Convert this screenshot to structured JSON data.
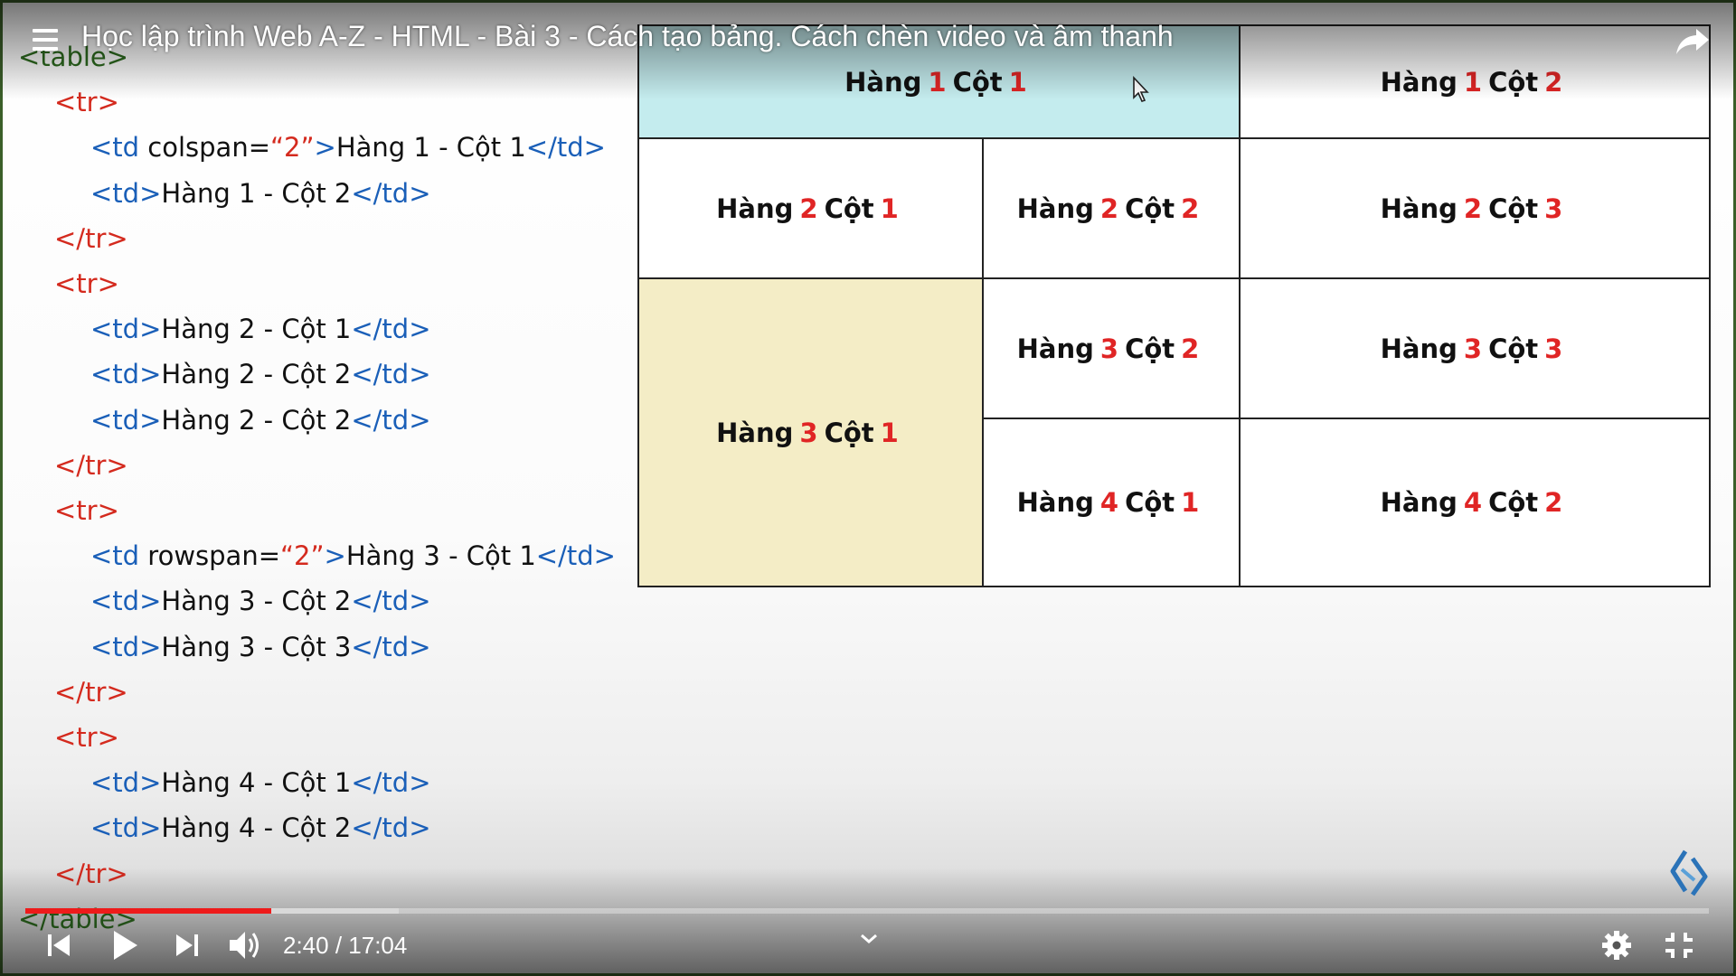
{
  "video": {
    "title": "Học lập trình Web A-Z - HTML - Bài 3 - Cách tạo bảng. Cách chèn video và âm thanh",
    "current_time": "2:40",
    "separator": " / ",
    "duration": "17:04",
    "progress_played": 0.146,
    "progress_buffered": 0.222
  },
  "code_lines": [
    [
      {
        "t": "<table>",
        "c": "grn"
      }
    ],
    [
      {
        "t": "<tr>",
        "c": "red"
      }
    ],
    [
      {
        "t": "<td ",
        "c": "blue"
      },
      {
        "t": "colspan=",
        "c": "blk"
      },
      {
        "t": "“2”",
        "c": "red"
      },
      {
        "t": ">",
        "c": "blue"
      },
      {
        "t": "Hàng 1 - Cột 1",
        "c": "blk"
      },
      {
        "t": "</td>",
        "c": "blue"
      }
    ],
    [
      {
        "t": "<td>",
        "c": "blue"
      },
      {
        "t": "Hàng 1 - Cột 2",
        "c": "blk"
      },
      {
        "t": "</td>",
        "c": "blue"
      }
    ],
    [
      {
        "t": "</tr>",
        "c": "red"
      }
    ],
    [
      {
        "t": "<tr>",
        "c": "red"
      }
    ],
    [
      {
        "t": "<td>",
        "c": "blue"
      },
      {
        "t": "Hàng 2 - Cột 1",
        "c": "blk"
      },
      {
        "t": "</td>",
        "c": "blue"
      }
    ],
    [
      {
        "t": "<td>",
        "c": "blue"
      },
      {
        "t": "Hàng 2 - Cột 2",
        "c": "blk"
      },
      {
        "t": "</td>",
        "c": "blue"
      }
    ],
    [
      {
        "t": "<td>",
        "c": "blue"
      },
      {
        "t": "Hàng 2 - Cột 2",
        "c": "blk"
      },
      {
        "t": "</td>",
        "c": "blue"
      }
    ],
    [
      {
        "t": "</tr>",
        "c": "red"
      }
    ],
    [
      {
        "t": "<tr>",
        "c": "red"
      }
    ],
    [
      {
        "t": "<td ",
        "c": "blue"
      },
      {
        "t": "rowspan=",
        "c": "blk"
      },
      {
        "t": "“2”",
        "c": "red"
      },
      {
        "t": ">",
        "c": "blue"
      },
      {
        "t": "Hàng 3 - Cột 1",
        "c": "blk"
      },
      {
        "t": "</td>",
        "c": "blue"
      }
    ],
    [
      {
        "t": "<td>",
        "c": "blue"
      },
      {
        "t": "Hàng 3 - Cột 2",
        "c": "blk"
      },
      {
        "t": "</td>",
        "c": "blue"
      }
    ],
    [
      {
        "t": "<td>",
        "c": "blue"
      },
      {
        "t": "Hàng 3 - Cột 3",
        "c": "blk"
      },
      {
        "t": "</td>",
        "c": "blue"
      }
    ],
    [
      {
        "t": "</tr>",
        "c": "red"
      }
    ],
    [
      {
        "t": "<tr>",
        "c": "red"
      }
    ],
    [
      {
        "t": "<td>",
        "c": "blue"
      },
      {
        "t": "Hàng 4 - Cột 1",
        "c": "blk"
      },
      {
        "t": "</td>",
        "c": "blue"
      }
    ],
    [
      {
        "t": "<td>",
        "c": "blue"
      },
      {
        "t": "Hàng 4 - Cột 2",
        "c": "blk"
      },
      {
        "t": "</td>",
        "c": "blue"
      }
    ],
    [
      {
        "t": "</tr>",
        "c": "red"
      }
    ],
    [
      {
        "t": "</table>",
        "c": "grn"
      }
    ]
  ],
  "table_cells": [
    {
      "id": "r1c1",
      "word1": "Hàng",
      "row": "1",
      "word2": "Cột",
      "col": "1",
      "fill": "#c4ecee"
    },
    {
      "id": "r1c2",
      "word1": "Hàng",
      "row": "1",
      "word2": "Cột",
      "col": "2",
      "fill": "#ffffff"
    },
    {
      "id": "r2c1",
      "word1": "Hàng",
      "row": "2",
      "word2": "Cột",
      "col": "1",
      "fill": "#ffffff"
    },
    {
      "id": "r2c2",
      "word1": "Hàng",
      "row": "2",
      "word2": "Cột",
      "col": "2",
      "fill": "#ffffff"
    },
    {
      "id": "r2c3",
      "word1": "Hàng",
      "row": "2",
      "word2": "Cột",
      "col": "3",
      "fill": "#ffffff"
    },
    {
      "id": "r3c1",
      "word1": "Hàng",
      "row": "3",
      "word2": "Cột",
      "col": "1",
      "fill": "#f4edc6"
    },
    {
      "id": "r3c2",
      "word1": "Hàng",
      "row": "3",
      "word2": "Cột",
      "col": "2",
      "fill": "#ffffff"
    },
    {
      "id": "r3c3",
      "word1": "Hàng",
      "row": "3",
      "word2": "Cột",
      "col": "3",
      "fill": "#ffffff"
    },
    {
      "id": "r4c1",
      "word1": "Hàng",
      "row": "4",
      "word2": "Cột",
      "col": "1",
      "fill": "#ffffff"
    },
    {
      "id": "r4c2",
      "word1": "Hàng",
      "row": "4",
      "word2": "Cột",
      "col": "2",
      "fill": "#ffffff"
    }
  ],
  "icons": {
    "menu": "menu-icon",
    "share": "share-icon",
    "previous": "previous-icon",
    "play": "play-icon",
    "next": "next-icon",
    "volume": "volume-icon",
    "chevron": "chevron-down-icon",
    "settings": "gear-icon",
    "exit_fullscreen": "exit-fullscreen-icon",
    "logo": "channel-logo"
  },
  "colors": {
    "progress_played": "#ee1b1b",
    "tag_red": "#d42a1e",
    "tag_blue": "#1a5fb8",
    "highlight_cyan": "#c4ecee",
    "highlight_beige": "#f4edc6"
  }
}
